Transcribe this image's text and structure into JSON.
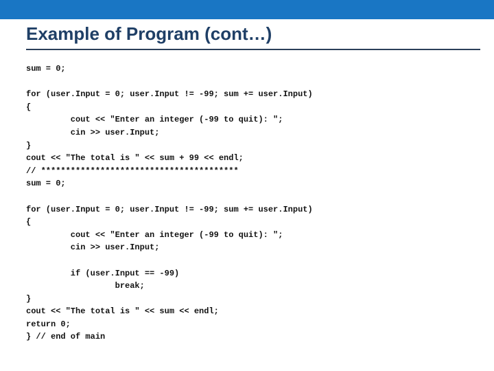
{
  "title": "Example of Program (cont…)",
  "code": "sum = 0;\n\nfor (user.Input = 0; user.Input != -99; sum += user.Input)\n{\n         cout << \"Enter an integer (-99 to quit): \";\n         cin >> user.Input;\n}\ncout << \"The total is \" << sum + 99 << endl;\n// ****************************************\nsum = 0;\n\nfor (user.Input = 0; user.Input != -99; sum += user.Input)\n{\n         cout << \"Enter an integer (-99 to quit): \";\n         cin >> user.Input;\n\n         if (user.Input == -99)\n                  break;\n}\ncout << \"The total is \" << sum << endl;\nreturn 0;\n} // end of main"
}
